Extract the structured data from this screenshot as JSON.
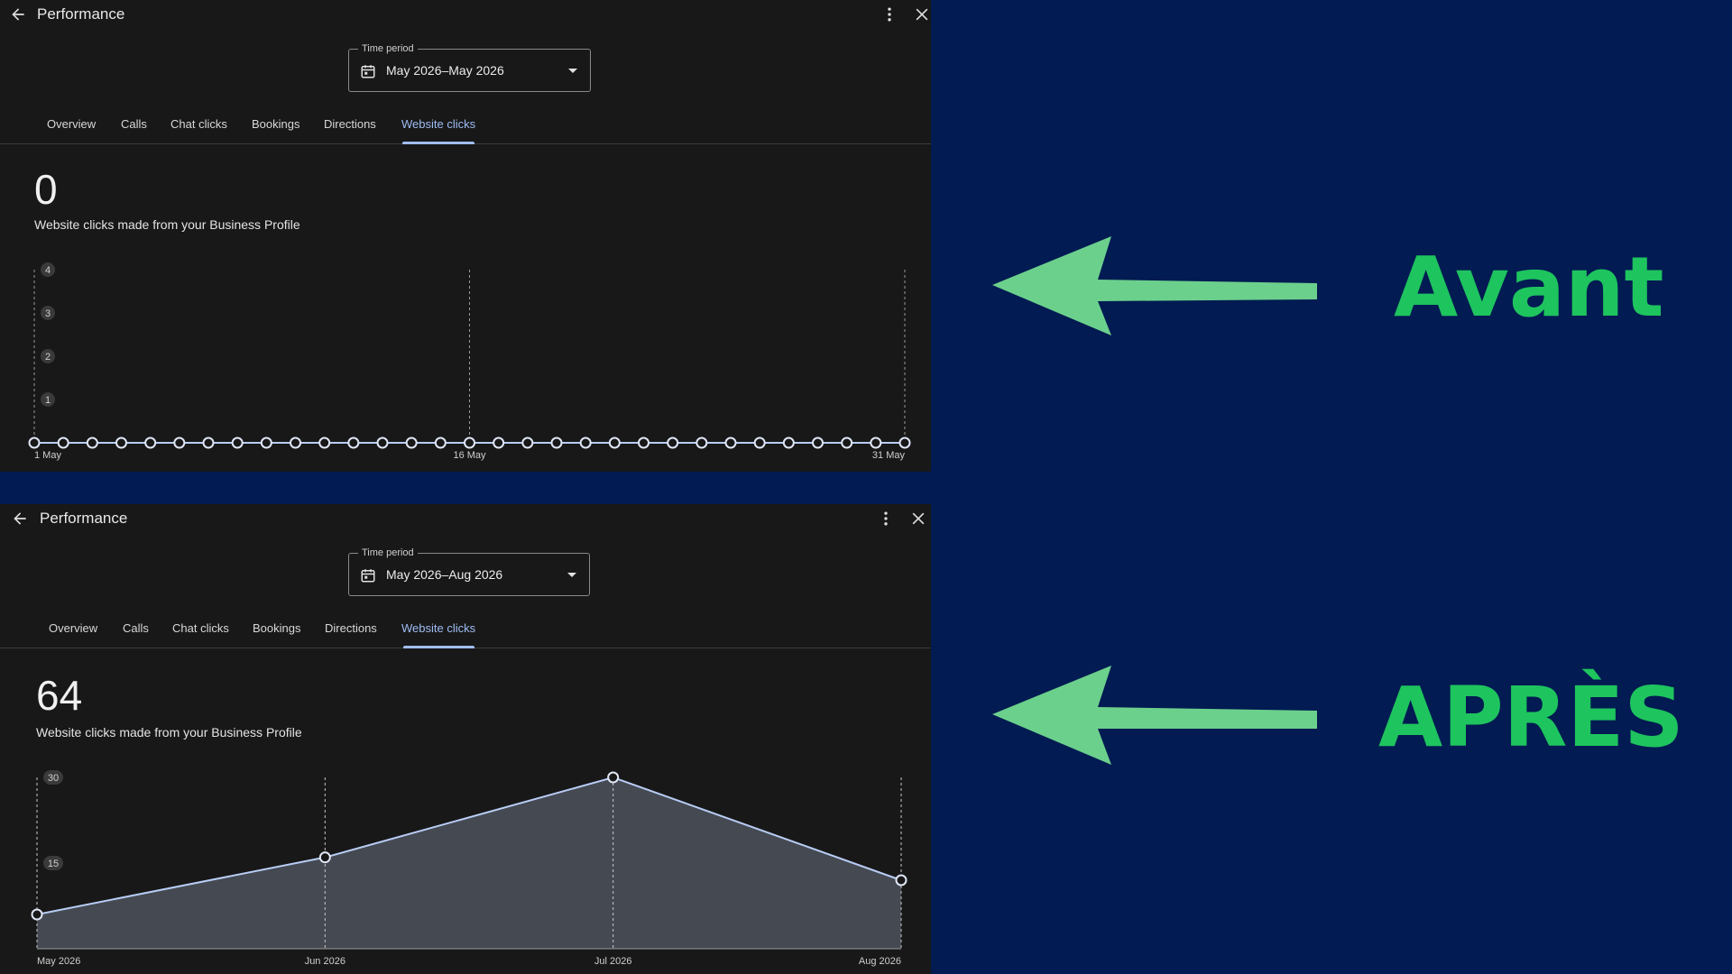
{
  "before": {
    "window_title": "Performance",
    "time_label": "Time period",
    "time_value": "May 2026–May 2026",
    "tabs": [
      "Overview",
      "Calls",
      "Chat clicks",
      "Bookings",
      "Directions",
      "Website clicks"
    ],
    "active_tab": "Website clicks",
    "total": "0",
    "description": "Website clicks made from your Business Profile",
    "chart_data": {
      "type": "line",
      "x": [
        "1 May",
        "2 May",
        "3 May",
        "4 May",
        "5 May",
        "6 May",
        "7 May",
        "8 May",
        "9 May",
        "10 May",
        "11 May",
        "12 May",
        "13 May",
        "14 May",
        "15 May",
        "16 May",
        "17 May",
        "18 May",
        "19 May",
        "20 May",
        "21 May",
        "22 May",
        "23 May",
        "24 May",
        "25 May",
        "26 May",
        "27 May",
        "28 May",
        "29 May",
        "30 May",
        "31 May"
      ],
      "values": [
        0,
        0,
        0,
        0,
        0,
        0,
        0,
        0,
        0,
        0,
        0,
        0,
        0,
        0,
        0,
        0,
        0,
        0,
        0,
        0,
        0,
        0,
        0,
        0,
        0,
        0,
        0,
        0,
        0,
        0,
        0
      ],
      "x_tick_labels": [
        "1 May",
        "16 May",
        "31 May"
      ],
      "y_ticks": [
        4,
        3,
        2,
        1
      ],
      "ylim": [
        0,
        4
      ]
    }
  },
  "after": {
    "window_title": "Performance",
    "time_label": "Time period",
    "time_value": "May 2026–Aug 2026",
    "tabs": [
      "Overview",
      "Calls",
      "Chat clicks",
      "Bookings",
      "Directions",
      "Website clicks"
    ],
    "active_tab": "Website clicks",
    "total": "64",
    "description": "Website clicks made from your Business Profile",
    "chart_data": {
      "type": "area",
      "x": [
        "May 2026",
        "Jun 2026",
        "Jul 2026",
        "Aug 2026"
      ],
      "values": [
        6,
        16,
        30,
        12
      ],
      "y_ticks": [
        30,
        15
      ],
      "ylim": [
        0,
        30
      ]
    }
  },
  "labels": {
    "before": "Avant",
    "after": "APRÈS"
  },
  "colors": {
    "background": "#021b52",
    "panel": "#181818",
    "accent_tab": "#9fbdf5",
    "arrow": "#6bd08c",
    "label_text": "#1ec45e",
    "area_fill": "#454a52"
  }
}
